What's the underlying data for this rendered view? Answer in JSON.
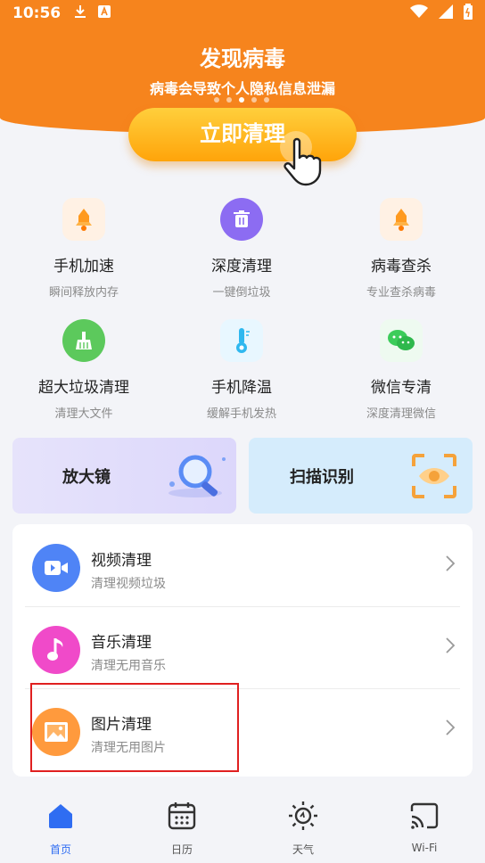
{
  "status_bar": {
    "time": "10:56",
    "icons": [
      "download-icon",
      "a-icon",
      "wifi-icon",
      "signal-icon",
      "battery-icon"
    ]
  },
  "banner": {
    "title": "发现病毒",
    "subtitle": "病毒会导致个人隐私信息泄漏",
    "pager_count": 5,
    "pager_active": 2,
    "button_label": "立即清理"
  },
  "grid": [
    {
      "label": "手机加速",
      "sub": "瞬间释放内存",
      "icon": "rocket-bell-icon"
    },
    {
      "label": "深度清理",
      "sub": "一键倒垃圾",
      "icon": "trash-icon"
    },
    {
      "label": "病毒查杀",
      "sub": "专业查杀病毒",
      "icon": "virus-bell-icon"
    },
    {
      "label": "超大垃圾清理",
      "sub": "清理大文件",
      "icon": "broom-icon"
    },
    {
      "label": "手机降温",
      "sub": "缓解手机发热",
      "icon": "thermometer-icon"
    },
    {
      "label": "微信专清",
      "sub": "深度清理微信",
      "icon": "wechat-icon"
    }
  ],
  "cards": [
    {
      "label": "放大镜",
      "icon": "magnifier-icon"
    },
    {
      "label": "扫描识别",
      "icon": "scan-eye-icon"
    }
  ],
  "list": [
    {
      "title": "视频清理",
      "sub": "清理视频垃圾",
      "icon": "video-icon",
      "color": "#4f84f6"
    },
    {
      "title": "音乐清理",
      "sub": "清理无用音乐",
      "icon": "music-note-icon",
      "color": "#f04ac9"
    },
    {
      "title": "图片清理",
      "sub": "清理无用图片",
      "icon": "image-icon",
      "color": "#ff9a3d"
    }
  ],
  "nav": [
    {
      "label": "首页",
      "icon": "home-icon",
      "active": true
    },
    {
      "label": "日历",
      "icon": "calendar-icon",
      "active": false
    },
    {
      "label": "天气",
      "icon": "sun-icon",
      "active": false
    },
    {
      "label": "Wi-Fi",
      "icon": "cast-icon",
      "active": false
    }
  ],
  "colors": {
    "accent": "#f6841d",
    "button": "#ffb11f",
    "nav_active": "#2f6df2",
    "highlight": "#e02020"
  }
}
